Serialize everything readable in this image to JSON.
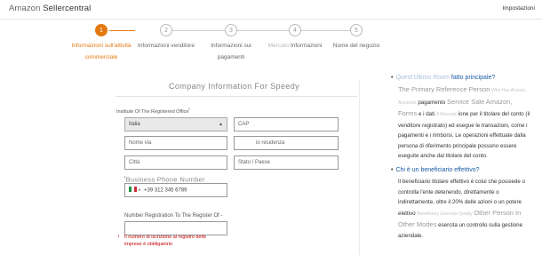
{
  "header": {
    "brand_primary": "Amazon",
    "brand_secondary": "Sellercentral",
    "settings_label": "Impostazioni"
  },
  "steps": [
    {
      "number": "1",
      "label_line1": "Informazioni sull'attività",
      "label_line2": "commerciale",
      "active": true
    },
    {
      "number": "2",
      "label_line1": "Informazioni venditore",
      "label_line2": "",
      "active": false
    },
    {
      "number": "3",
      "label_line1": "Informazioni sui",
      "label_line2": "pagamenti",
      "active": false
    },
    {
      "number": "4",
      "label_line1_faint": "Mercato",
      "label_line1": "Informazioni",
      "label_line2": "",
      "active": false
    },
    {
      "number": "5",
      "label_line1": "Nome del negozio",
      "label_line2": "",
      "active": false
    }
  ],
  "form": {
    "title": "Company Information For Speedy",
    "office_label": "Institute Of The Registered Office",
    "required_mark": "!",
    "country_value": "Italia",
    "cap_placeholder": "CAP",
    "street_placeholder": "Nome via",
    "residence_placeholder": "io residenza",
    "city_placeholder": "Città",
    "state_placeholder": "Stato / Paese",
    "phone_label": "Business Phone Number",
    "phone_value": "+39 312 345 6789",
    "registration_label": "Number Registration To The Register Of -",
    "error_line1": "Il numero di iscrizione al registro delle",
    "error_line2": "imprese è obbligatorio",
    "error_mark": "!"
  },
  "help": [
    {
      "question_faint": "Quest'Ultimo Room",
      "question": "fatto principale?",
      "answer_overlay": "The Primary Reference Person",
      "answer_part1": "Who Has Access",
      "answer_faint1": "Accounts",
      "answer_part2": "pagamento",
      "answer_overlay2": "Service Sale Amazon, Forms",
      "answer_part3": "e i dati",
      "answer_faint2": "A Records",
      "answer_rest": "ione per il titolare del conto (il venditore registrato) ed esegue le transazioni, come i pagamenti e i rimborsi. Le operazioni effettuate dalla persona di riferimento principale possono essere eseguite anche dal titolare del conto."
    },
    {
      "question": "Chi è un beneficiario effettivo?",
      "answer_rest": "Il beneficiario titolare effettivo è colui che possiede o controlla l'ente detenendo, direttamente o indirettamente, oltre il 20% delle azioni o un potere elettivo",
      "answer_faint1": "Beneficiary Exercise Quality",
      "answer_overlay": "Other Person In Other Modes",
      "answer_tail": "esercita un controllo sulla gestione aziendale."
    }
  ],
  "colors": {
    "accent": "#e47911",
    "link": "#1a5ba6",
    "error": "#c40000"
  }
}
